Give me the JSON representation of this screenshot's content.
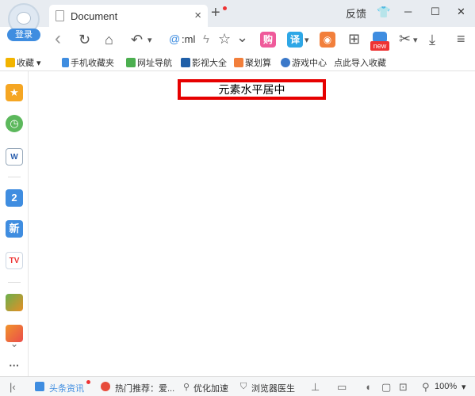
{
  "titlebar": {
    "login_label": "登录",
    "tab_title": "Document",
    "close_glyph": "×",
    "newtab_glyph": "+",
    "feedback_label": "反馈",
    "shirt_glyph": "👕",
    "min_glyph": "─",
    "max_glyph": "☐",
    "close_window_glyph": "✕"
  },
  "navbar": {
    "back_glyph": "‹",
    "reload_glyph": "↻",
    "home_glyph": "⌂",
    "undo_glyph": "↶",
    "dropdown_glyph": "▾",
    "url_at": "@",
    "url_text": ":ml",
    "bolt_glyph": "ϟ",
    "star_glyph": "☆",
    "chevron_glyph": "⌄",
    "shop_glyph": "购",
    "translate_glyph": "译",
    "game_glyph": "◉",
    "apps_glyph": "⊞",
    "new_badge": "new",
    "cut_glyph": "✂",
    "download_glyph": "⤓",
    "menu_glyph": "≡"
  },
  "bookmarks": {
    "items": [
      "收藏",
      "手机收藏夹",
      "网址导航",
      "影视大全",
      "聚划算",
      "游戏中心",
      "点此导入收藏"
    ]
  },
  "sidebar": {
    "items": [
      "★",
      "◷",
      "W",
      "2",
      "新",
      "TV"
    ],
    "more_glyph": "···",
    "scroll_glyph": "⌄"
  },
  "content": {
    "boxed_text": "元素水平居中"
  },
  "statusbar": {
    "left_glyph": "|‹",
    "news_label": "头条资讯",
    "hot_label": "热门推荐：爱...",
    "optimize_label": "优化加速",
    "doctor_label": "浏览器医生",
    "zoom_label": "100%"
  }
}
